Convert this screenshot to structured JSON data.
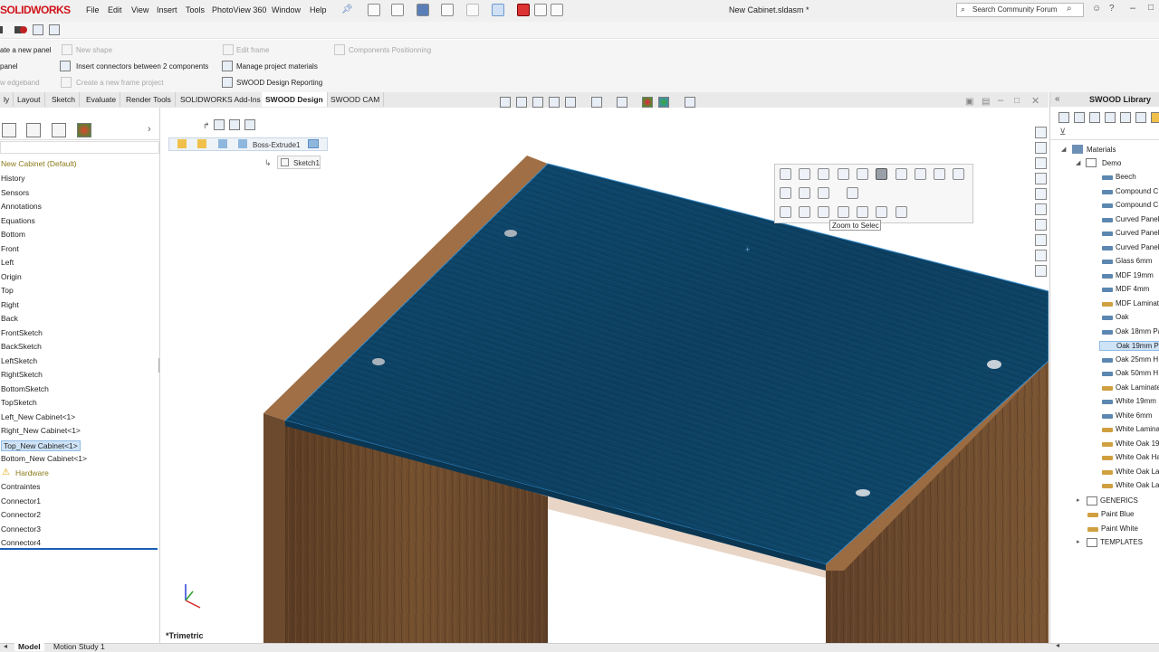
{
  "app": {
    "logo": "SOLIDWORKS",
    "document_title": "New Cabinet.sldasm *"
  },
  "menu": [
    "File",
    "Edit",
    "View",
    "Insert",
    "Tools",
    "PhotoView 360",
    "Window",
    "Help"
  ],
  "search": {
    "placeholder": "Search Community Forum"
  },
  "commands": {
    "row1": [
      "ate a new panel",
      "New shape",
      "Edit frame",
      "Components Positionning"
    ],
    "row2": [
      "panel",
      "Insert connectors between 2 components",
      "Manage project materials"
    ],
    "row3": [
      "w edgeband",
      "Create a new frame project",
      "SWOOD Design Reporting"
    ]
  },
  "tabs": [
    "ly",
    "Layout",
    "Sketch",
    "Evaluate",
    "Render Tools",
    "SOLIDWORKS Add-Ins",
    "SWOOD Design",
    "SWOOD CAM"
  ],
  "active_tab": "SWOOD Design",
  "breadcrumb": {
    "feature": "Boss-Extrude1",
    "sketch": "Sketch1"
  },
  "tree": {
    "root": "New Cabinet  (Default)",
    "items": [
      "History",
      "Sensors",
      "Annotations",
      "Equations",
      "Bottom",
      "Front",
      "Left",
      "Origin",
      "Top",
      "Right",
      "Back",
      "FrontSketch",
      "BackSketch",
      "LeftSketch",
      "RightSketch",
      "BottomSketch",
      "TopSketch",
      "Left_New Cabinet<1>",
      "Right_New Cabinet<1>",
      "Top_New Cabinet<1>",
      "Bottom_New Cabinet<1>",
      "Hardware",
      "Contraintes",
      "Connector1",
      "Connector2",
      "Connector3",
      "Connector4"
    ],
    "selected": "Top_New Cabinet<1>",
    "warning_item": "Hardware"
  },
  "tooltip": "Zoom to Selec",
  "view_orientation": "*Trimetric",
  "library": {
    "title": "SWOOD Library",
    "root": "Materials",
    "folder": "Demo",
    "items": [
      {
        "label": "Beech",
        "color": "#5b87b0"
      },
      {
        "label": "Compound C",
        "color": "#5b87b0"
      },
      {
        "label": "Compound C",
        "color": "#5b87b0"
      },
      {
        "label": "Curved Panel",
        "color": "#5b87b0"
      },
      {
        "label": "Curved Panel",
        "color": "#5b87b0"
      },
      {
        "label": "Curved Panel",
        "color": "#5b87b0"
      },
      {
        "label": "Glass 6mm",
        "color": "#5b87b0"
      },
      {
        "label": "MDF 19mm",
        "color": "#5b87b0"
      },
      {
        "label": "MDF 4mm",
        "color": "#5b87b0"
      },
      {
        "label": "MDF Laminat",
        "color": "#d0a040"
      },
      {
        "label": "Oak",
        "color": "#5b87b0"
      },
      {
        "label": "Oak 18mm Pa",
        "color": "#5b87b0"
      },
      {
        "label": "Oak 19mm Pa",
        "color": "#5b87b0"
      },
      {
        "label": "Oak 25mm H",
        "color": "#5b87b0"
      },
      {
        "label": "Oak 50mm H",
        "color": "#5b87b0"
      },
      {
        "label": "Oak Laminate",
        "color": "#d0a040"
      },
      {
        "label": "White 19mm",
        "color": "#5b87b0"
      },
      {
        "label": "White 6mm",
        "color": "#5b87b0"
      },
      {
        "label": "White Lamina",
        "color": "#d0a040"
      },
      {
        "label": "White Oak 19",
        "color": "#d0a040"
      },
      {
        "label": "White Oak Ha",
        "color": "#d0a040"
      },
      {
        "label": "White Oak La",
        "color": "#d0a040"
      },
      {
        "label": "White Oak La",
        "color": "#d0a040"
      }
    ],
    "selected_index": 12,
    "groups": [
      "GENERICS",
      "Paint Blue",
      "Paint White",
      "TEMPLATES"
    ]
  },
  "bottom_tabs": [
    "Model",
    "Motion Study 1"
  ],
  "colors": {
    "panel_blue": "#0f4566",
    "wood": "#6b4a2e",
    "wood_edge": "#9b6b42",
    "logo_red": "#d0141b"
  }
}
